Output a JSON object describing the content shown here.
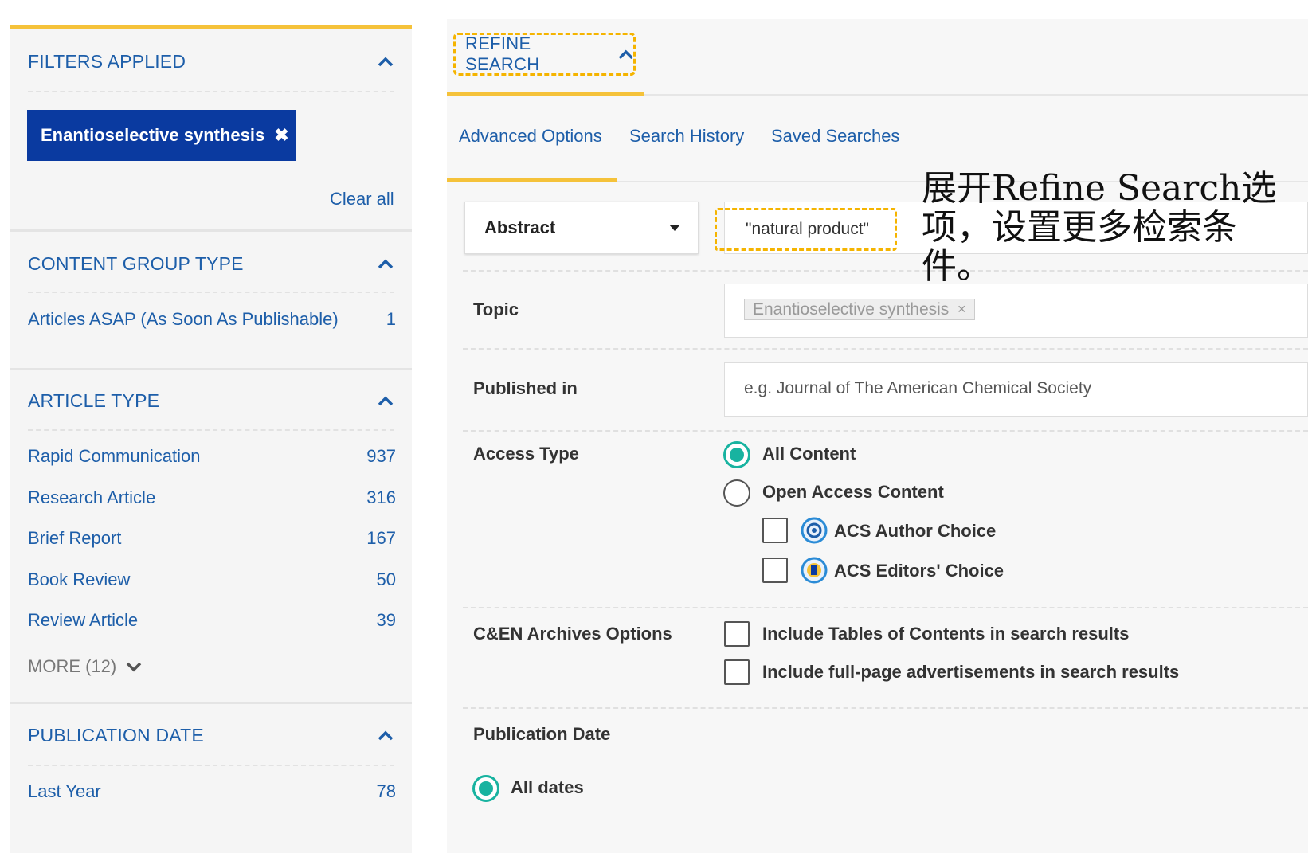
{
  "sidebar": {
    "filters_applied": {
      "title": "FILTERS APPLIED",
      "chip": "Enantioselective synthesis",
      "clear_all": "Clear all"
    },
    "content_group_type": {
      "title": "CONTENT GROUP TYPE",
      "items": [
        {
          "label": "Articles ASAP (As Soon As Publishable)",
          "count": "1"
        }
      ]
    },
    "article_type": {
      "title": "ARTICLE TYPE",
      "items": [
        {
          "label": "Rapid Communication",
          "count": "937"
        },
        {
          "label": "Research Article",
          "count": "316"
        },
        {
          "label": "Brief Report",
          "count": "167"
        },
        {
          "label": "Book Review",
          "count": "50"
        },
        {
          "label": "Review Article",
          "count": "39"
        }
      ],
      "more": "MORE (12)"
    },
    "publication_date": {
      "title": "PUBLICATION DATE",
      "items": [
        {
          "label": "Last Year",
          "count": "78"
        }
      ]
    }
  },
  "main": {
    "refine_search": "REFINE SEARCH",
    "tabs": [
      "Advanced Options",
      "Search History",
      "Saved Searches"
    ],
    "field_select": "Abstract",
    "search_value": "\"natural product\"",
    "topic": {
      "label": "Topic",
      "tag": "Enantioselective synthesis"
    },
    "published_in": {
      "label": "Published in",
      "placeholder": "e.g. Journal of The American Chemical Society"
    },
    "access_type": {
      "label": "Access Type",
      "options": [
        "All Content",
        "Open Access Content"
      ],
      "sub_options": [
        "ACS Author Choice",
        "ACS Editors' Choice"
      ],
      "selected": "All Content"
    },
    "cen_archives": {
      "label": "C&EN Archives Options",
      "options": [
        "Include Tables of Contents in search results",
        "Include full-page advertisements in search results"
      ]
    },
    "publication_date": {
      "label": "Publication Date",
      "option": "All dates"
    }
  },
  "annotation": {
    "text": "展开Refine Search选项，设置更多检索条件。"
  },
  "colors": {
    "accent_yellow": "#f5c23a",
    "link_blue": "#1d5ea9",
    "chip_blue": "#0a3aa0",
    "radio_teal": "#18b3a0"
  }
}
